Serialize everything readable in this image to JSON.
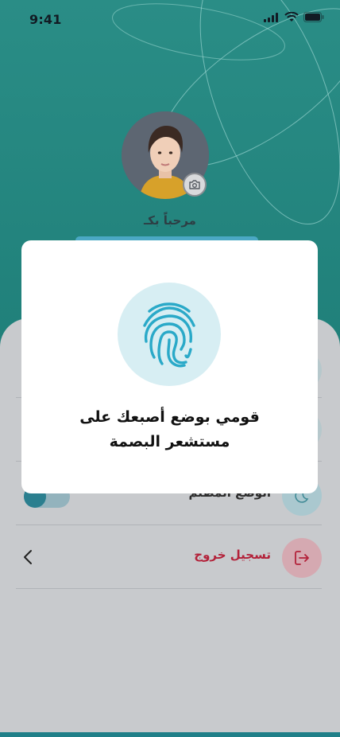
{
  "status_bar": {
    "time": "9:41"
  },
  "profile": {
    "welcome": "مرحباً بكـ"
  },
  "settings": {
    "rows": [
      {
        "label": ""
      },
      {
        "label": ""
      },
      {
        "label": "الوضع المظلم"
      },
      {
        "label": "تسجيل خروج"
      }
    ]
  },
  "modal": {
    "line1": "قومي بوضع أصبعك على",
    "line2": "مستشعر البصمة"
  },
  "colors": {
    "teal": "#1f7f79",
    "accent_red": "#b3223a",
    "fingerprint": "#2aa9c8"
  },
  "icons": {
    "camera": "camera-icon",
    "fingerprint": "fingerprint-icon",
    "logout": "logout-icon",
    "chevron": "chevron-left-icon"
  }
}
